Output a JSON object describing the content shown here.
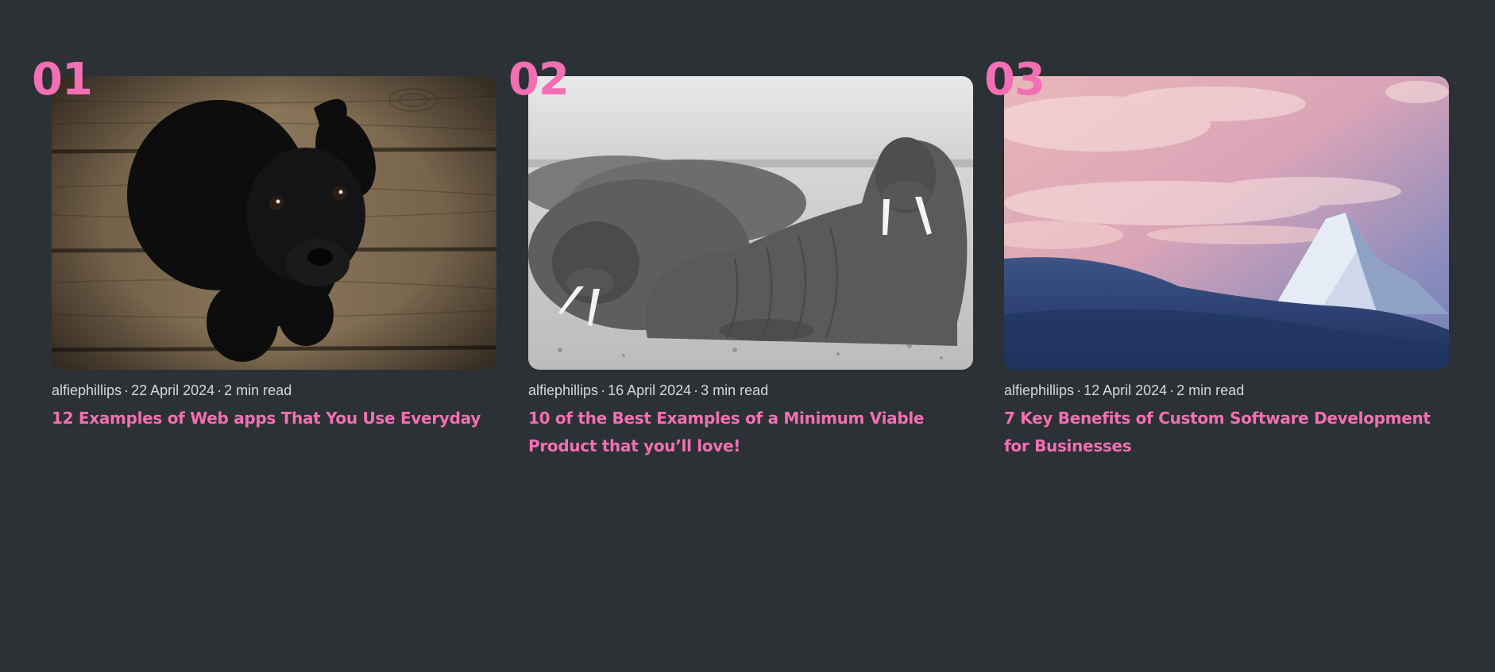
{
  "theme": {
    "background": "#2b3135",
    "accent": "#f26fb3",
    "meta_text": "#d4d7da"
  },
  "separator": "·",
  "posts": [
    {
      "index": "01",
      "image": "black-puppy-on-wooden-floor",
      "author": "alfiephillips",
      "date": "22 April 2024",
      "read_time": "2 min read",
      "title": "12 Examples of Web apps That You Use Everyday"
    },
    {
      "index": "02",
      "image": "walruses-on-beach-black-and-white",
      "author": "alfiephillips",
      "date": "16 April 2024",
      "read_time": "3 min read",
      "title": "10 of the Best Examples of a Minimum Viable Product that you’ll love!"
    },
    {
      "index": "03",
      "image": "snowy-mountain-peak-at-dusk",
      "author": "alfiephillips",
      "date": "12 April 2024",
      "read_time": "2 min read",
      "title": "7 Key Benefits of Custom Software Development for Businesses"
    }
  ]
}
